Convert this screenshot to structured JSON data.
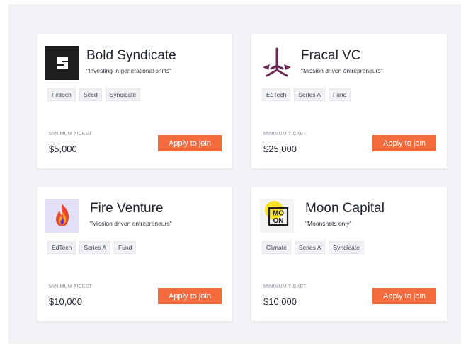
{
  "cards": [
    {
      "name": "Bold Syndicate",
      "tagline": "\"Investing in generational shifts\"",
      "tags": [
        "Fintech",
        "Seed",
        "Syndicate"
      ],
      "min_label": "MINIMUM TICKET",
      "min_value": "$5,000",
      "button": "Apply to join",
      "logo_icon": "bold-syndicate-logo-icon",
      "logo_bg": "#1f1f1f"
    },
    {
      "name": "Fracal VC",
      "tagline": "\"Mission driven entrepreneurs\"",
      "tags": [
        "EdTech",
        "Series A",
        "Fund"
      ],
      "min_label": "MINIMUM TICKET",
      "min_value": "$25,000",
      "button": "Apply to join",
      "logo_icon": "fracal-vc-logo-icon",
      "logo_color": "#6b2a57"
    },
    {
      "name": "Fire Venture",
      "tagline": "\"Mission driven entrepreneurs\"",
      "tags": [
        "EdTech",
        "Series A",
        "Fund"
      ],
      "min_label": "MINIMUM TICKET",
      "min_value": "$10,000",
      "button": "Apply to join",
      "logo_icon": "fire-venture-logo-icon",
      "logo_bg": "#e4e0f6"
    },
    {
      "name": "Moon Capital",
      "tagline": "\"Moonshots only\"",
      "tags": [
        "Climate",
        "Series A",
        "Syndicate"
      ],
      "min_label": "MINIMUM TICKET",
      "min_value": "$10,000",
      "button": "Apply to join",
      "logo_icon": "moon-capital-logo-icon",
      "logo_text": [
        "MO",
        "ON"
      ],
      "logo_accent": "#f5e12c"
    }
  ],
  "colors": {
    "accent": "#f36a3d",
    "page_bg": "#f2f3f7",
    "card_bg": "#ffffff"
  }
}
